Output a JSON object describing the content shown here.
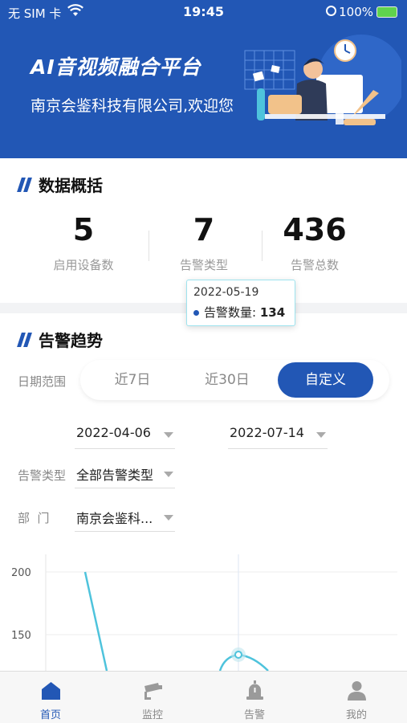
{
  "status_bar": {
    "carrier": "无 SIM 卡",
    "time": "19:45",
    "battery": "100%"
  },
  "header": {
    "app_title": "AI音视频融合平台",
    "welcome": "南京会鉴科技有限公司,欢迎您"
  },
  "overview": {
    "title": "数据概括",
    "stats": [
      {
        "value": "5",
        "label": "启用设备数"
      },
      {
        "value": "7",
        "label": "告警类型"
      },
      {
        "value": "436",
        "label": "告警总数"
      }
    ]
  },
  "trend": {
    "title": "告警趋势",
    "date_range_label": "日期范围",
    "range_options": [
      "近7日",
      "近30日",
      "自定义"
    ],
    "active_range": "自定义",
    "start_date": "2022-04-06",
    "end_date": "2022-07-14",
    "alarm_type_label": "告警类型",
    "alarm_type_value": "全部告警类型",
    "department_label": "部  门",
    "department_value": "南京会鉴科..."
  },
  "chart_data": {
    "type": "line",
    "y_ticks": [
      "200",
      "150"
    ],
    "visible_points": [
      {
        "x": "start",
        "y": 200
      },
      {
        "x": "2022-05-19",
        "y": 134
      }
    ],
    "tooltip": {
      "date": "2022-05-19",
      "series": "告警数量",
      "value": 134
    },
    "line_color": "#4ec3dc",
    "ylim_visible": [
      120,
      205
    ]
  },
  "tabbar": {
    "tabs": [
      {
        "label": "首页",
        "icon": "home-icon",
        "active": true
      },
      {
        "label": "监控",
        "icon": "camera-icon",
        "active": false
      },
      {
        "label": "告警",
        "icon": "alarm-icon",
        "active": false
      },
      {
        "label": "我的",
        "icon": "user-icon",
        "active": false
      }
    ]
  },
  "colors": {
    "brand": "#2257b5",
    "line": "#4ec3dc",
    "muted": "#888888"
  }
}
